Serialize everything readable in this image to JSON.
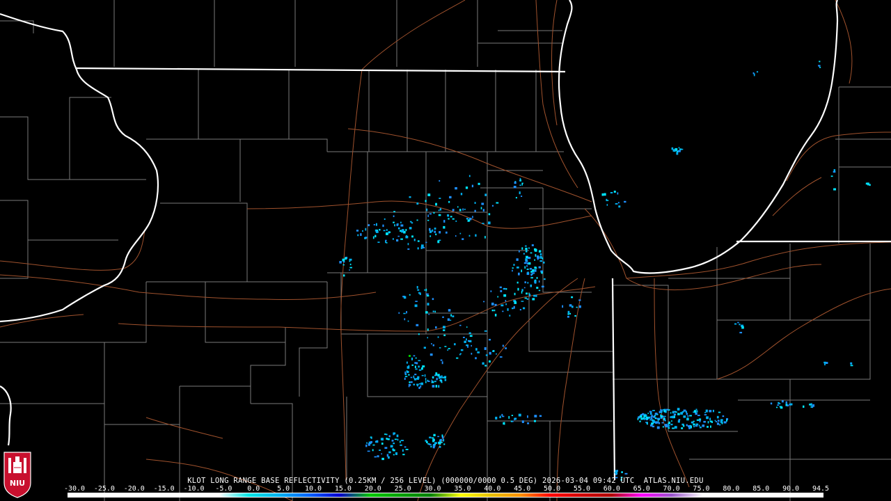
{
  "product": {
    "caption": "KLOT LONG RANGE BASE REFLECTIVITY (0.25KM / 256 LEVEL) (000000/0000 0.5 DEG) 2026-03-04 09:42 UTC  ATLAS.NIU.EDU"
  },
  "colorbar": {
    "ticks": [
      "-30.0",
      "-25.0",
      "-20.0",
      "-15.0",
      "-10.0",
      "-5.0",
      "0.0",
      "5.0",
      "10.0",
      "15.0",
      "20.0",
      "25.0",
      "30.0",
      "35.0",
      "40.0",
      "45.0",
      "50.0",
      "55.0",
      "60.0",
      "65.0",
      "70.0",
      "75.0",
      "80.0",
      "85.0",
      "90.0",
      "94.5"
    ],
    "colors": [
      "#ffffff",
      "#ffffff",
      "#ffffff",
      "#ffffff",
      "#ffffff",
      "#ffffff",
      "#00e5e5",
      "#00b0f0",
      "#0060ff",
      "#0000d0",
      "#00c800",
      "#00a000",
      "#008000",
      "#ffff00",
      "#e6c000",
      "#ff9000",
      "#ff0000",
      "#d00000",
      "#b00000",
      "#ff00ff",
      "#9955cc",
      "#ffffff",
      "#ffffff",
      "#ffffff",
      "#ffffff"
    ]
  },
  "logo": {
    "text": "NIU"
  },
  "map": {
    "state_border_color": "#ffffff",
    "county_line_color": "#7a7a7a",
    "highway_color": "#a0522d",
    "echo_colors": [
      "#00e5ff",
      "#00b0f0",
      "#1e90ff",
      "#00c800"
    ]
  }
}
